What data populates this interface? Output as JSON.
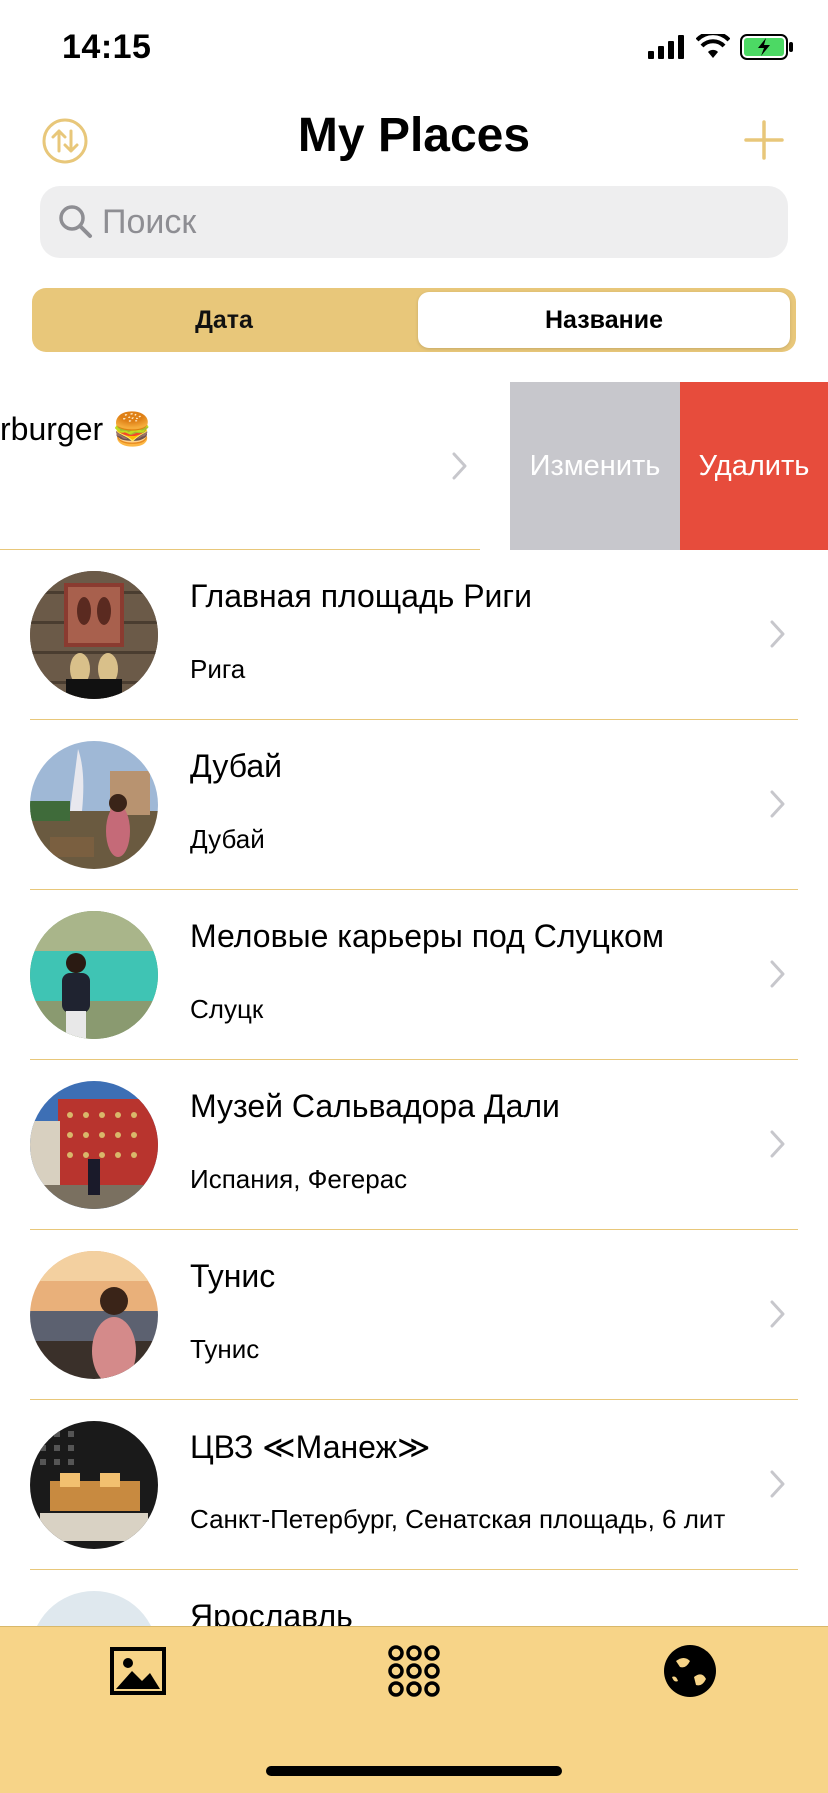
{
  "status": {
    "time": "14:15"
  },
  "nav": {
    "title": "My Places"
  },
  "search": {
    "placeholder": "Поиск"
  },
  "segments": [
    "Дата",
    "Название"
  ],
  "swiped_row": {
    "title": "rburger 🍔",
    "actions": {
      "edit": "Изменить",
      "delete": "Удалить"
    }
  },
  "places": [
    {
      "title": "Главная площадь Риги",
      "subtitle": "Рига"
    },
    {
      "title": "Дубай",
      "subtitle": "Дубай"
    },
    {
      "title": "Меловые карьеры под Слуцком",
      "subtitle": "Слуцк"
    },
    {
      "title": "Музей Сальвадора Дали",
      "subtitle": "Испания, Фегерас"
    },
    {
      "title": "Тунис",
      "subtitle": "Тунис"
    },
    {
      "title": "ЦВЗ ≪Манеж≫",
      "subtitle": "Санкт-Петербург, Сенатская площадь, 6 лит"
    },
    {
      "title": "Ярославль",
      "subtitle": ""
    }
  ],
  "tabbar": {
    "icons": [
      "image-icon",
      "grid-icon",
      "globe-icon"
    ]
  },
  "colors": {
    "accent": "#e8c77a",
    "tabbar": "#f7d488",
    "delete": "#e74c3c",
    "edit": "#c7c7cc"
  }
}
